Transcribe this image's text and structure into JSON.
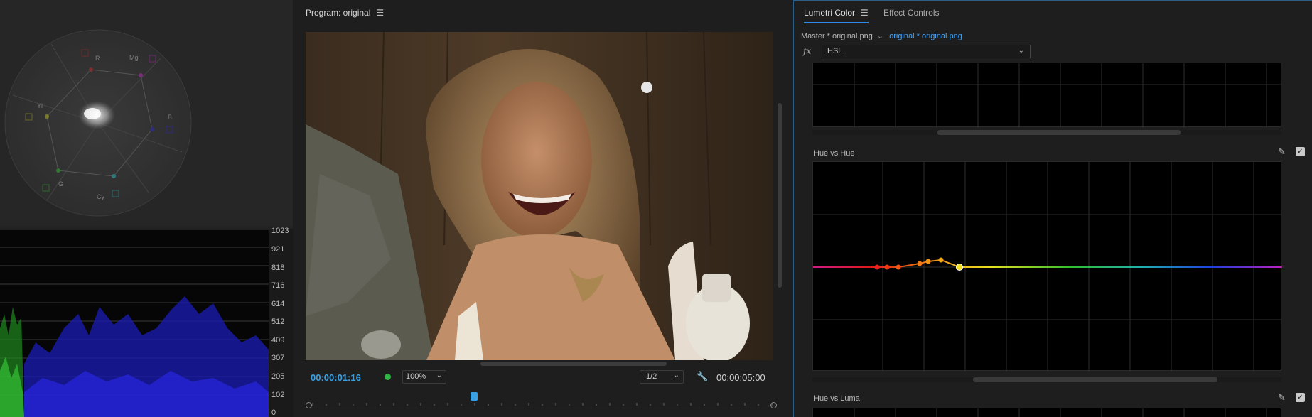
{
  "scopes": {
    "vectorscope": {
      "labels": [
        "R",
        "Mg",
        "B",
        "Cy",
        "G",
        "Yl"
      ]
    },
    "parade_scale": [
      "1023",
      "921",
      "818",
      "716",
      "614",
      "512",
      "409",
      "307",
      "205",
      "102",
      "0"
    ]
  },
  "program": {
    "title": "Program: original",
    "menu_icon": "hamburger-menu-icon",
    "timecode_current": "00:00:01:16",
    "zoom": "100%",
    "resolution": "1/2",
    "timecode_duration": "00:00:05:00"
  },
  "lumetri": {
    "tabs": [
      {
        "label": "Lumetri Color",
        "active": true
      },
      {
        "label": "Effect Controls",
        "active": false
      }
    ],
    "clip_master": "Master * original.png",
    "clip_selected": "original * original.png",
    "fx_label": "fx",
    "effect_select": "HSL",
    "sections": [
      {
        "label": "Hue vs Hue"
      },
      {
        "label": "Hue vs Luma"
      }
    ],
    "colors": {
      "accent": "#2d8ceb",
      "timecode": "#3aa0e4"
    }
  }
}
